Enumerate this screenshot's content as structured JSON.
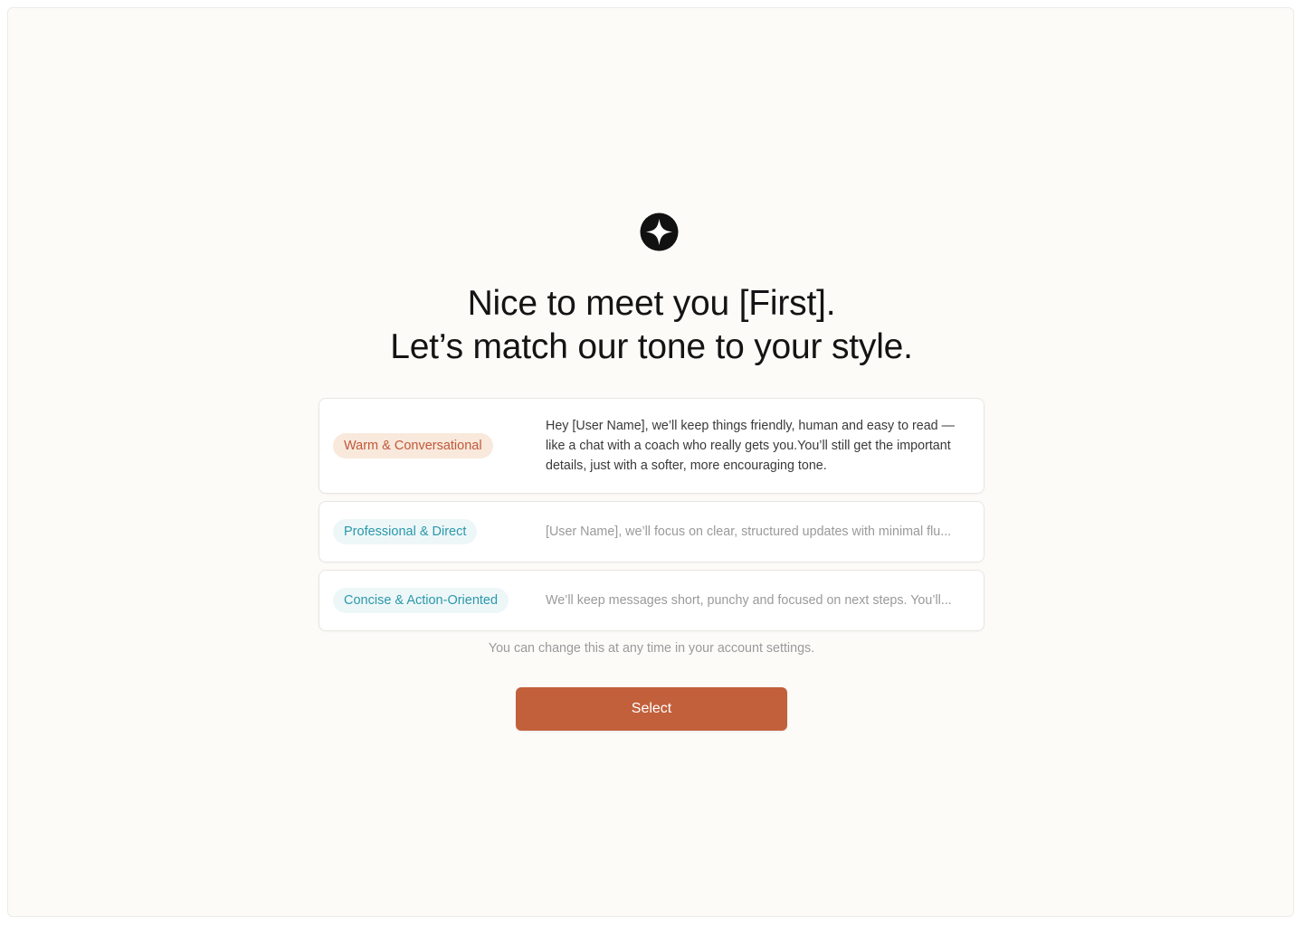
{
  "brand": {
    "icon": "sparkle-icon",
    "icon_bg_color": "#111111",
    "icon_fg_color": "#ffffff"
  },
  "heading": {
    "line1": "Nice to meet you [First].",
    "line2": "Let’s match our tone to your style."
  },
  "tones": [
    {
      "label": "Warm & Conversational",
      "description": "Hey [User Name], we’ll keep things friendly, human and easy to read — like a chat with a coach who really gets you.You’ll still get the important details, just with a softer, more encouraging tone.",
      "expanded": true,
      "label_color": "#c2583a"
    },
    {
      "label": "Professional & Direct",
      "description": "[User Name], we’ll focus on clear, structured updates with minimal flu...",
      "expanded": false,
      "label_color": "#2a98ac"
    },
    {
      "label": "Concise & Action-Oriented",
      "description": "We’ll keep messages short, punchy and focused on next steps. You’ll...",
      "expanded": false,
      "label_color": "#2a98ac"
    }
  ],
  "hint": "You can change this at any time in your account settings.",
  "actions": {
    "select_label": "Select",
    "accent_color": "#c2603c"
  }
}
